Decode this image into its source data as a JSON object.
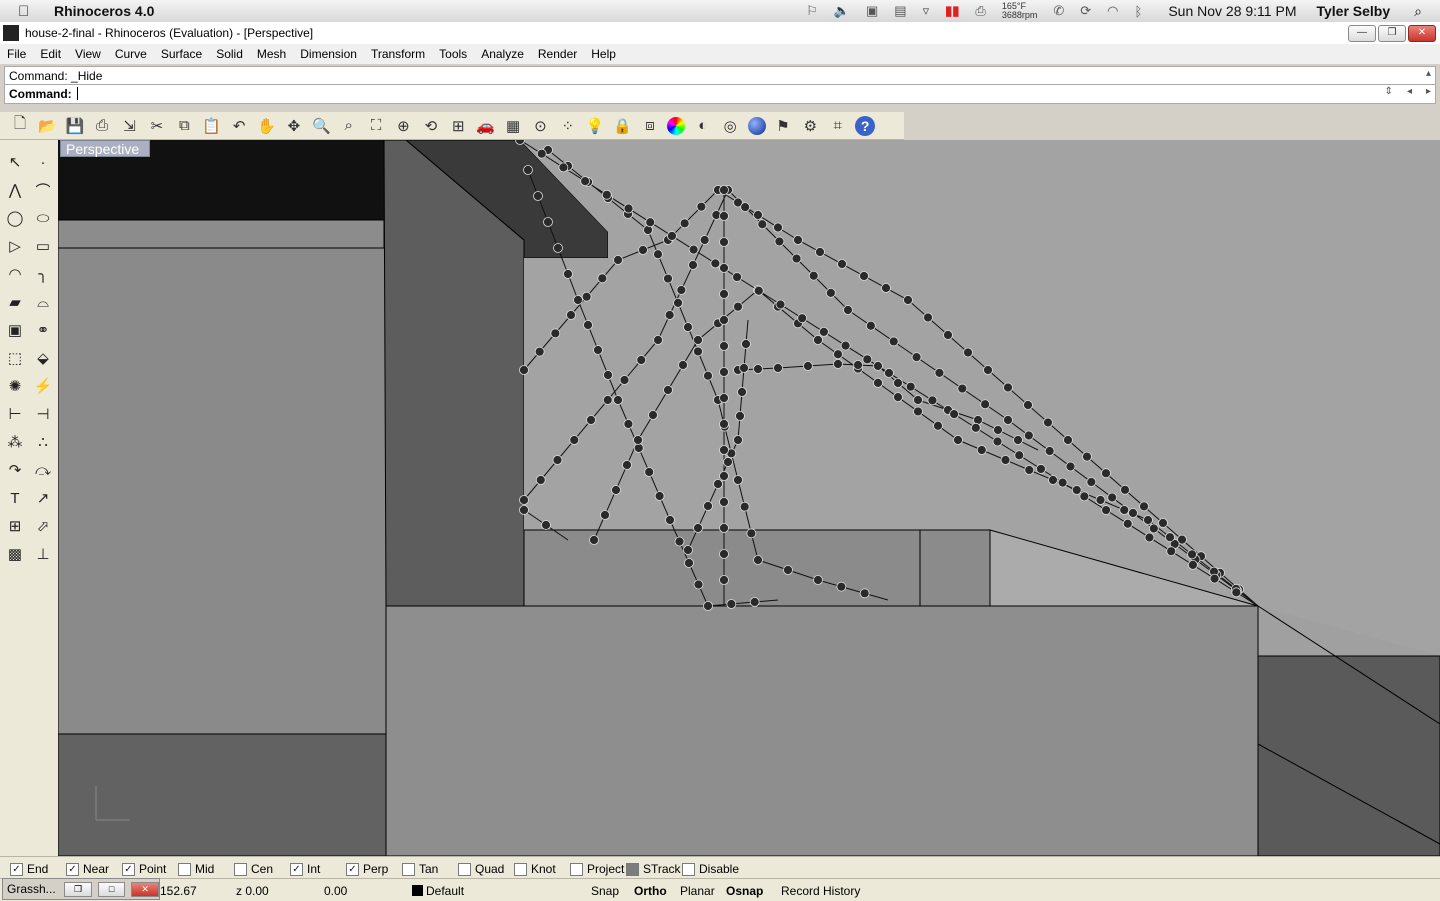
{
  "mac_menubar": {
    "app_name": "Rhinoceros 4.0",
    "temp": "165°F",
    "rpm": "3688rpm",
    "datetime": "Sun Nov 28  9:11 PM",
    "user": "Tyler Selby"
  },
  "window": {
    "title": "house-2-final - Rhinoceros (Evaluation) - [Perspective]"
  },
  "menu": [
    "File",
    "Edit",
    "View",
    "Curve",
    "Surface",
    "Solid",
    "Mesh",
    "Dimension",
    "Transform",
    "Tools",
    "Analyze",
    "Render",
    "Help"
  ],
  "command": {
    "history": "Command: _Hide",
    "prompt": "Command:",
    "value": ""
  },
  "toolbar_icons": [
    "new-icon",
    "open-icon",
    "save-icon",
    "print-icon",
    "import-icon",
    "cut-icon",
    "copy-icon",
    "paste-icon",
    "undo-icon",
    "pan-icon",
    "rotate-view-icon",
    "zoom-icon",
    "zoom-window-icon",
    "zoom-extents-icon",
    "zoom-selected-icon",
    "rotate-icon",
    "four-viewports-icon",
    "car-icon",
    "grid-icon",
    "osnap-icon",
    "points-icon",
    "light-icon",
    "lock-icon",
    "layer-icon",
    "color-icon",
    "shade-icon",
    "render-preview-icon",
    "render-icon",
    "options-icon",
    "gear-icon",
    "tools-icon",
    "help-icon"
  ],
  "viewport": {
    "label": "Perspective"
  },
  "osnap": [
    {
      "label": "End",
      "checked": true
    },
    {
      "label": "Near",
      "checked": true
    },
    {
      "label": "Point",
      "checked": true
    },
    {
      "label": "Mid",
      "checked": false
    },
    {
      "label": "Cen",
      "checked": false
    },
    {
      "label": "Int",
      "checked": true
    },
    {
      "label": "Perp",
      "checked": true
    },
    {
      "label": "Tan",
      "checked": false
    },
    {
      "label": "Quad",
      "checked": false
    },
    {
      "label": "Knot",
      "checked": false
    },
    {
      "label": "Project",
      "checked": false
    },
    {
      "label": "STrack",
      "checked": false
    },
    {
      "label": "Disable",
      "checked": false
    }
  ],
  "status": {
    "grasshopper": "Grassh...",
    "x": "152.67",
    "z": "z 0.00",
    "dist": "0.00",
    "layer": "Default",
    "snap": "Snap",
    "ortho": "Ortho",
    "planar": "Planar",
    "osnap": "Osnap",
    "record_history": "Record History"
  }
}
